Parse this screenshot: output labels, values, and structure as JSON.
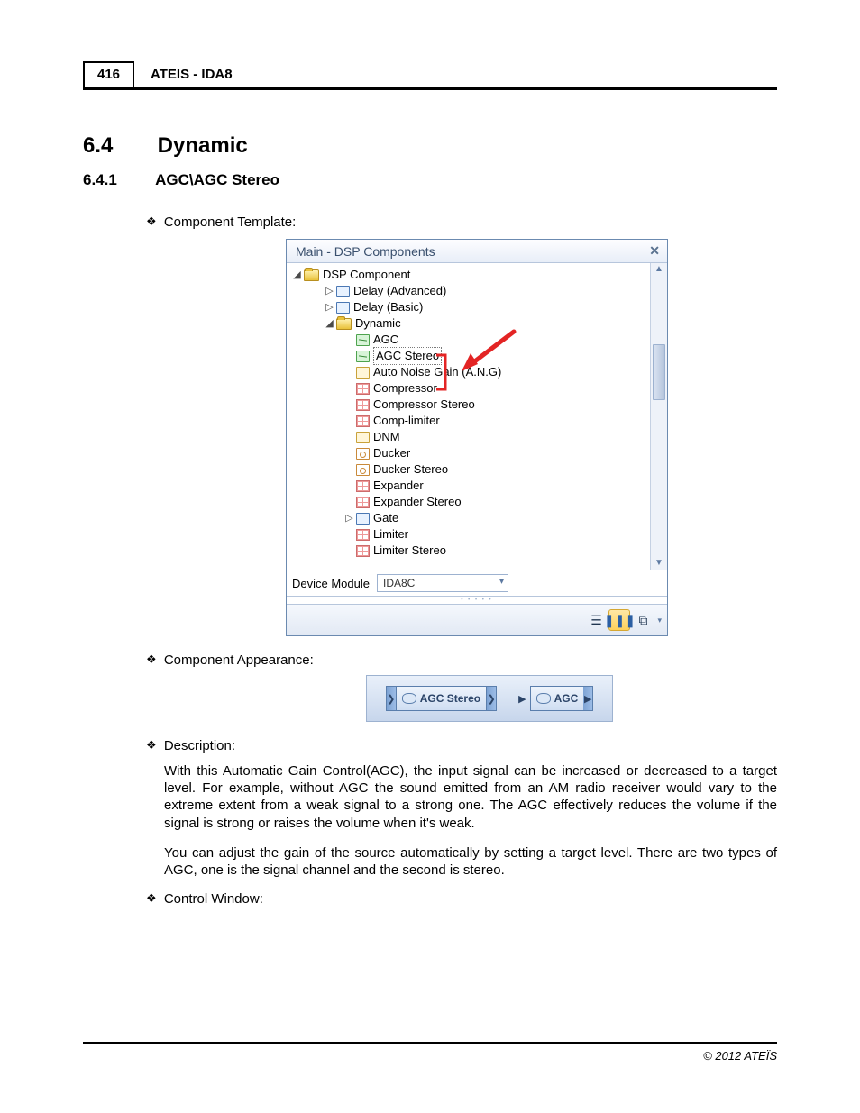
{
  "header": {
    "page_number": "416",
    "title": "ATEIS - IDA8"
  },
  "section": {
    "number": "6.4",
    "title": "Dynamic"
  },
  "subsection": {
    "number": "6.4.1",
    "title": "AGC\\AGC Stereo"
  },
  "bullets": {
    "component_template": "Component Template:",
    "component_appearance": "Component Appearance:",
    "description": "Description:",
    "control_window": "Control Window:"
  },
  "dsp_window": {
    "title": "Main - DSP Components",
    "root_label": "DSP Component",
    "nodes": [
      {
        "label": "Delay (Advanced)",
        "icon": "blue",
        "exp": "collapsed",
        "indent": 1
      },
      {
        "label": "Delay (Basic)",
        "icon": "blue",
        "exp": "collapsed",
        "indent": 1
      },
      {
        "label": "Dynamic",
        "icon": "folder",
        "exp": "expanded",
        "indent": 1
      },
      {
        "label": "AGC",
        "icon": "green",
        "indent": 2
      },
      {
        "label": "AGC Stereo",
        "icon": "green",
        "indent": 2,
        "selected": true
      },
      {
        "label": "Auto Noise Gain (A.N.G)",
        "icon": "anc",
        "indent": 2
      },
      {
        "label": "Compressor",
        "icon": "pinkgrid",
        "indent": 2
      },
      {
        "label": "Compressor Stereo",
        "icon": "pinkgrid",
        "indent": 2
      },
      {
        "label": "Comp-limiter",
        "icon": "pinkgrid",
        "indent": 2
      },
      {
        "label": "DNM",
        "icon": "anc",
        "indent": 2
      },
      {
        "label": "Ducker",
        "icon": "duck",
        "indent": 2
      },
      {
        "label": "Ducker Stereo",
        "icon": "duck",
        "indent": 2
      },
      {
        "label": "Expander",
        "icon": "pinkgrid",
        "indent": 2
      },
      {
        "label": "Expander Stereo",
        "icon": "pinkgrid",
        "indent": 2
      },
      {
        "label": "Gate",
        "icon": "blue",
        "exp": "collapsed",
        "indent": 2
      },
      {
        "label": "Limiter",
        "icon": "pinkgrid",
        "indent": 2
      },
      {
        "label": "Limiter Stereo",
        "icon": "pinkgrid",
        "indent": 2
      }
    ],
    "device_module_label": "Device Module",
    "device_module_value": "IDA8C"
  },
  "component_appearance": {
    "chip1": "AGC Stereo",
    "chip2": "AGC"
  },
  "description_paras": {
    "p1": "With this Automatic Gain Control(AGC), the input signal can be increased or decreased to a target level. For example, without AGC the sound emitted from an AM radio receiver would vary to the extreme extent from a weak signal to a strong one. The AGC effectively reduces the volume if the signal is strong or raises the volume when it's weak.",
    "p2": "You can adjust the gain of the source automatically by setting a target level. There are two types of AGC, one is the signal channel and the second is stereo."
  },
  "footer": "© 2012 ATEÏS"
}
